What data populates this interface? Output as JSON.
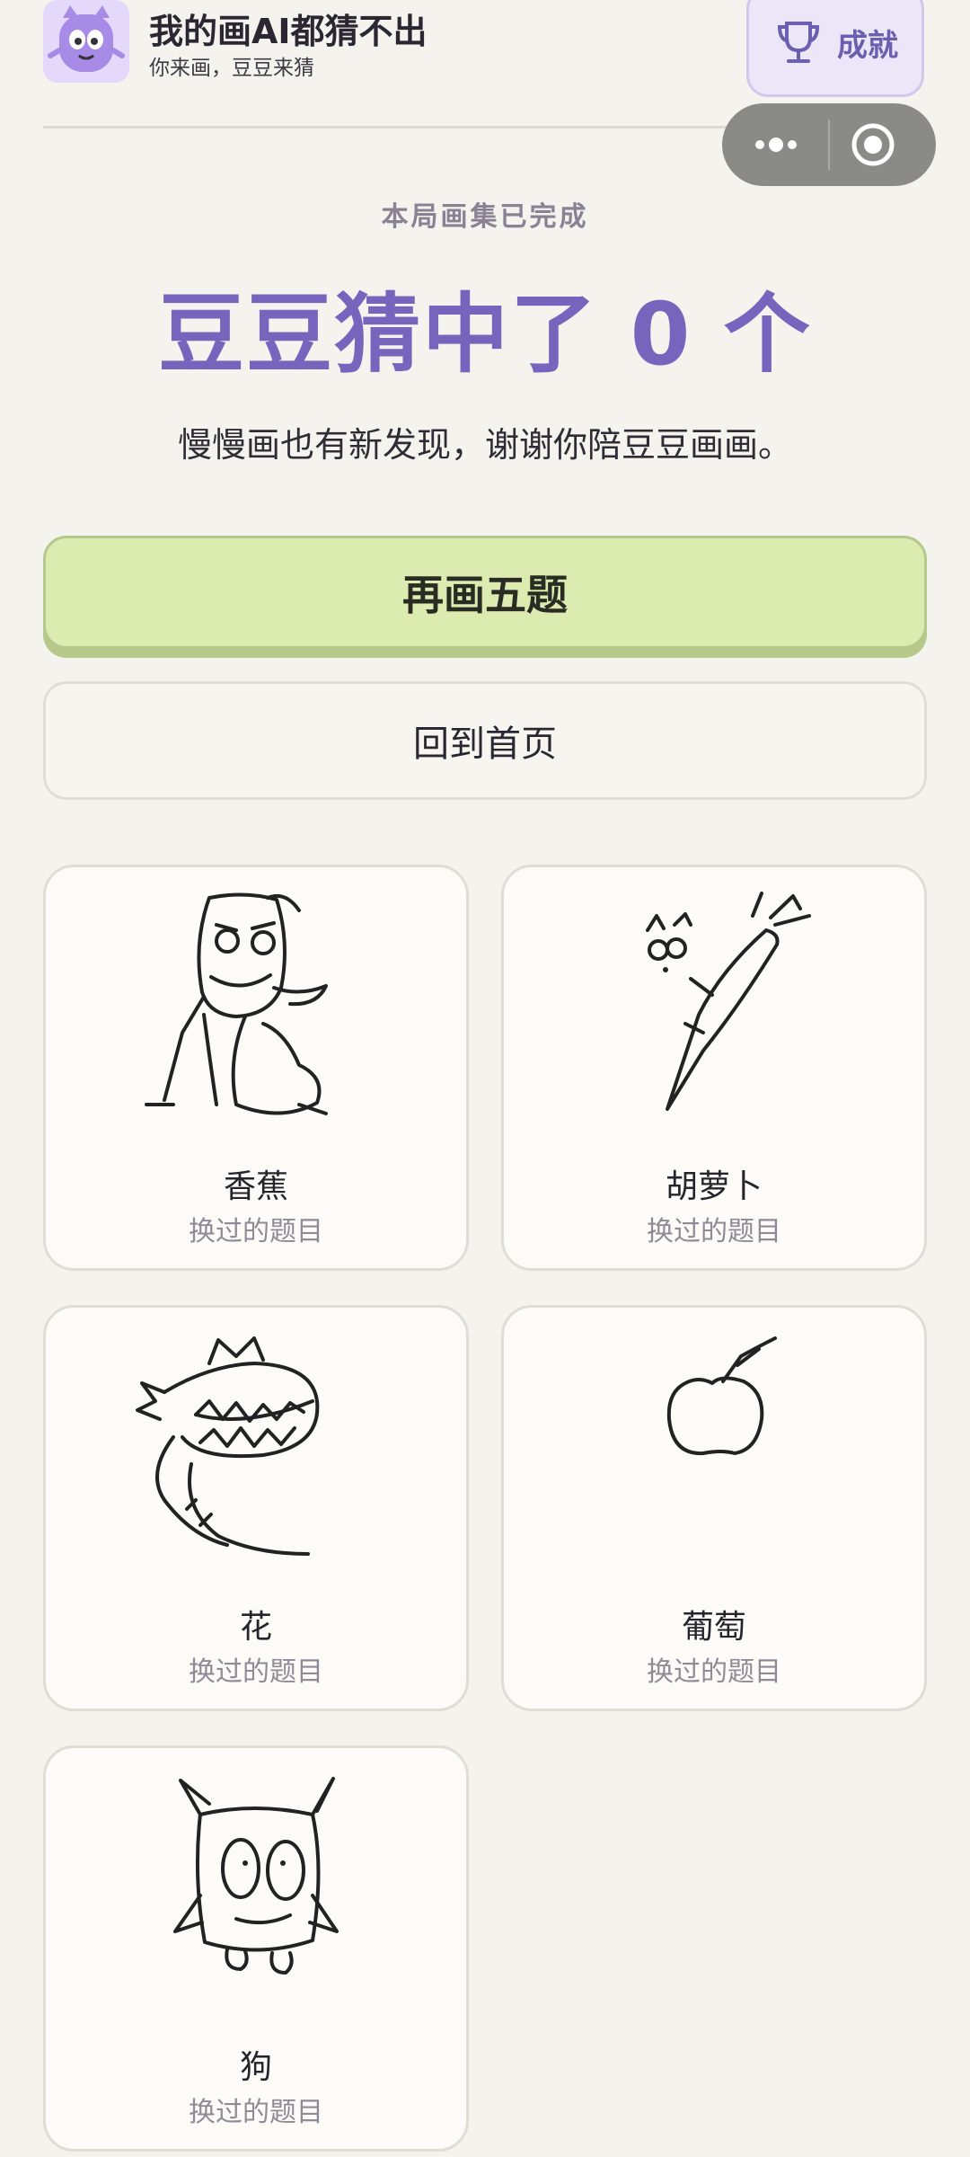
{
  "header": {
    "title": "我的画AI都猜不出",
    "subtitle": "你来画，豆豆来猜",
    "achievements_label": "成就"
  },
  "result": {
    "round_label": "本局画集已完成",
    "title": "豆豆猜中了 0 个",
    "message": "慢慢画也有新发现，谢谢你陪豆豆画画。"
  },
  "actions": {
    "replay_label": "再画五题",
    "home_label": "回到首页"
  },
  "drawings": [
    {
      "title": "香蕉",
      "status": "换过的题目",
      "icon": "monster-sketch"
    },
    {
      "title": "胡萝卜",
      "status": "换过的题目",
      "icon": "carrot-sketch"
    },
    {
      "title": "花",
      "status": "换过的题目",
      "icon": "chomper-plant-sketch"
    },
    {
      "title": "葡萄",
      "status": "换过的题目",
      "icon": "apple-sketch"
    },
    {
      "title": "狗",
      "status": "换过的题目",
      "icon": "horned-monster-sketch"
    }
  ],
  "colors": {
    "accent": "#7765bd",
    "primary_button": "#dcebb0",
    "background": "#f5f3ee"
  }
}
